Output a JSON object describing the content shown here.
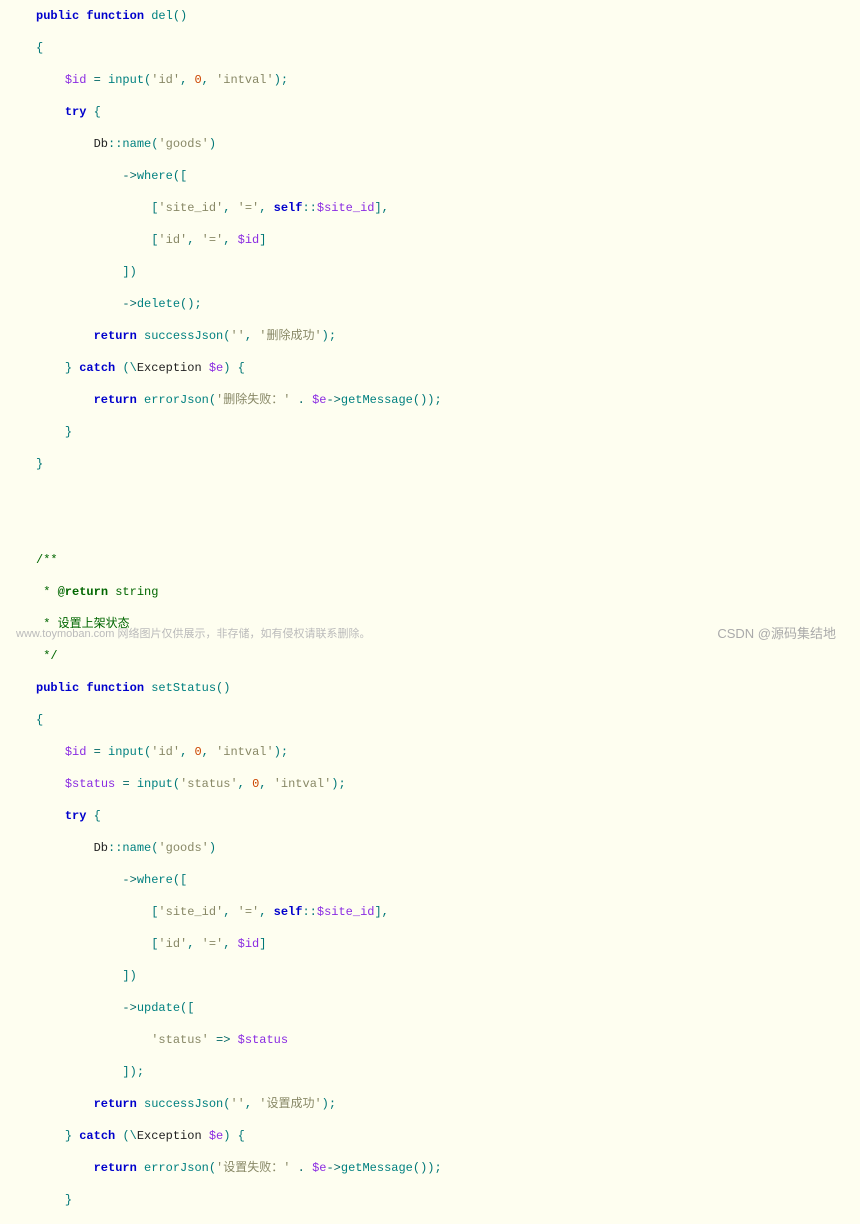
{
  "code": {
    "kw_public": "public",
    "kw_function": "function",
    "kw_try": "try",
    "kw_catch": "catch",
    "kw_return": "return",
    "kw_self": "self",
    "fn_del": "del",
    "fn_setStatus": "setStatus",
    "fn_input": "input",
    "fn_name": "name",
    "fn_where": "where",
    "fn_delete": "delete",
    "fn_update": "update",
    "fn_successJson": "successJson",
    "fn_errorJson": "errorJson",
    "fn_getMessage": "getMessage",
    "cls_Db": "Db",
    "cls_Exception": "Exception",
    "var_id": "$id",
    "var_status": "$status",
    "var_e": "$e",
    "var_site_id": "$site_id",
    "str_id": "'id'",
    "str_intval": "'intval'",
    "str_goods": "'goods'",
    "str_site_id": "'site_id'",
    "str_eq": "'='",
    "str_status": "'status'",
    "str_empty": "''",
    "str_del_ok": "'删除成功'",
    "str_del_fail": "'删除失败：'",
    "str_set_ok": "'设置成功'",
    "str_set_fail": "'设置失败：'",
    "num_zero": "0",
    "cmt_open": "/**",
    "cmt_star": " *",
    "cmt_return": "@return",
    "cmt_string": "string",
    "cmt_desc": "设置上架状态",
    "cmt_close": " */"
  },
  "watermark": {
    "left": "www.toymoban.com 网络图片仅供展示，非存储，如有侵权请联系删除。",
    "right": "CSDN @源码集结地"
  }
}
